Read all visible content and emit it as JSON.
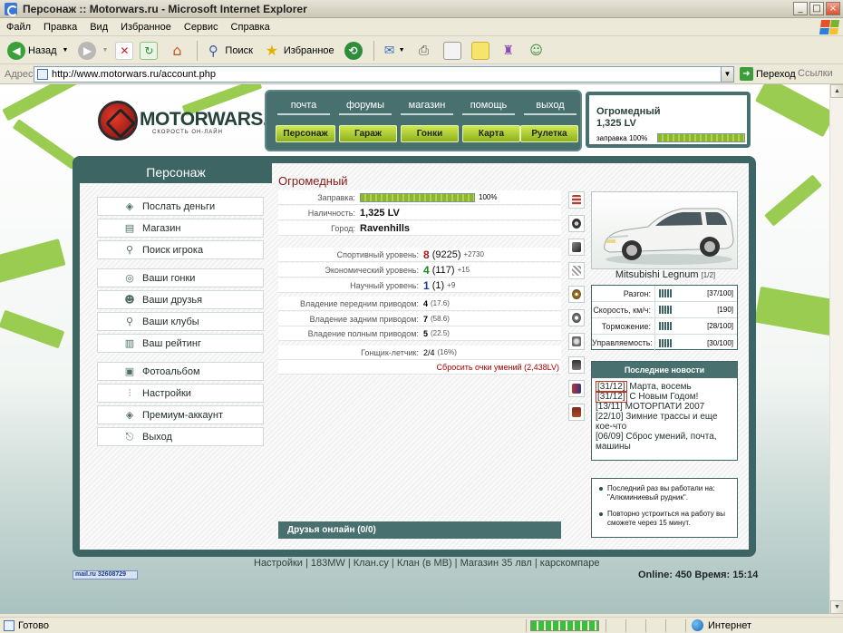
{
  "window": {
    "title": "Персонаж :: Motorwars.ru - Microsoft Internet Explorer",
    "buttons": {
      "minimize": "_",
      "maximize": "□",
      "close": "×"
    }
  },
  "menu": [
    "Файл",
    "Правка",
    "Вид",
    "Избранное",
    "Сервис",
    "Справка"
  ],
  "toolbar": {
    "back": "Назад",
    "search": "Поиск",
    "favorites": "Избранное"
  },
  "address": {
    "label": "Адрес:",
    "url": "http://www.motorwars.ru/account.php",
    "go": "Переход",
    "links": "Ссылки"
  },
  "site": {
    "logo": "MOTORWARS.RU",
    "tagline": "СКОРОСТЬ ОН-ЛАЙН",
    "topnav": [
      "почта",
      "форумы",
      "магазин",
      "помощь",
      "выход"
    ],
    "nav_buttons": [
      "Персонаж",
      "Гараж",
      "Гонки",
      "Карта",
      "Рулетка"
    ],
    "status": {
      "name": "Огромедный",
      "money": "1,325 LV",
      "fuel_label": "заправка 100%",
      "fuel_fraction": 1.0
    }
  },
  "sidebar": {
    "title": "Персонаж",
    "items": [
      {
        "label": "Послать деньги",
        "icon": "money-icon"
      },
      {
        "label": "Магазин",
        "icon": "shop-icon"
      },
      {
        "label": "Поиск игрока",
        "icon": "search-icon"
      },
      {
        "label": "Ваши гонки",
        "icon": "steering-wheel-icon"
      },
      {
        "label": "Ваши друзья",
        "icon": "friends-icon"
      },
      {
        "label": "Ваши клубы",
        "icon": "clubs-icon"
      },
      {
        "label": "Ваш рейтинг",
        "icon": "rating-icon"
      },
      {
        "label": "Фотоальбом",
        "icon": "photo-icon"
      },
      {
        "label": "Настройки",
        "icon": "settings-icon"
      },
      {
        "label": "Премиум-аккаунт",
        "icon": "premium-icon"
      },
      {
        "label": "Выход",
        "icon": "exit-icon"
      }
    ]
  },
  "character": {
    "name": "Огромедный",
    "fuel_label": "Заправка:",
    "fuel_value": "100%",
    "fuel_fraction": 1.0,
    "cash_label": "Наличность:",
    "cash_value": "1,325 LV",
    "city_label": "Город:",
    "city_value": "Ravenhills",
    "sport_label": "Спортивный уровень:",
    "sport_level": "8",
    "sport_points": "(9225)",
    "sport_delta": "+2730",
    "econ_label": "Экономический уровень:",
    "econ_level": "4",
    "econ_points": "(117)",
    "econ_delta": "+15",
    "sci_label": "Научный уровень:",
    "sci_level": "1",
    "sci_points": "(1)",
    "sci_delta": "+9",
    "fwd_label": "Владение передним приводом:",
    "fwd_value": "4",
    "fwd_points": "(17.6)",
    "rwd_label": "Владение задним приводом:",
    "rwd_value": "7",
    "rwd_points": "(58.6)",
    "awd_label": "Владение полным приводом:",
    "awd_value": "5",
    "awd_points": "(22.5)",
    "pilot_label": "Гонщик-летчик:",
    "pilot_value": "2/4",
    "pilot_points": "(16%)",
    "reset_link": "Сбросить очки умений (2,438LV)",
    "friends_online": "Друзья онлайн (0/0)"
  },
  "car": {
    "name": "Mitsubishi Legnum",
    "page": "[1/2]",
    "specs": [
      {
        "label": "Разгон:",
        "value": "[37/100]"
      },
      {
        "label": "Скорость, км/ч:",
        "value": "[190]"
      },
      {
        "label": "Торможение:",
        "value": "[28/100]"
      },
      {
        "label": "Управляемость:",
        "value": "[30/100]"
      }
    ]
  },
  "news": {
    "title": "Последние новости",
    "items": [
      {
        "date": "[31/12]",
        "text": "Марта, восемь"
      },
      {
        "date": "[31/12]",
        "text": "С Новым Годом!"
      },
      {
        "date": "[13/11]",
        "text": "МОТОРПАТИ 2007"
      },
      {
        "date": "[22/10]",
        "text": "Зимние трассы и еще кое-что"
      },
      {
        "date": "[06/09]",
        "text": "Сброс умений, почта, машины"
      }
    ]
  },
  "info": {
    "line1": "Последний раз вы работали на: \"Алюминиевый рудник\".",
    "line2": "Повторно устроиться на работу вы сможете через 15 минут."
  },
  "footer": {
    "links": "Настройки | 183MW | Клан.су | Клан (в МВ) | Магазин 35 лвл | карскомпаре",
    "counter": "mail.ru  32608729",
    "online": "Online: 450  Время: 15:14"
  },
  "statusbar": {
    "text": "Готово",
    "zone": "Интернет"
  }
}
